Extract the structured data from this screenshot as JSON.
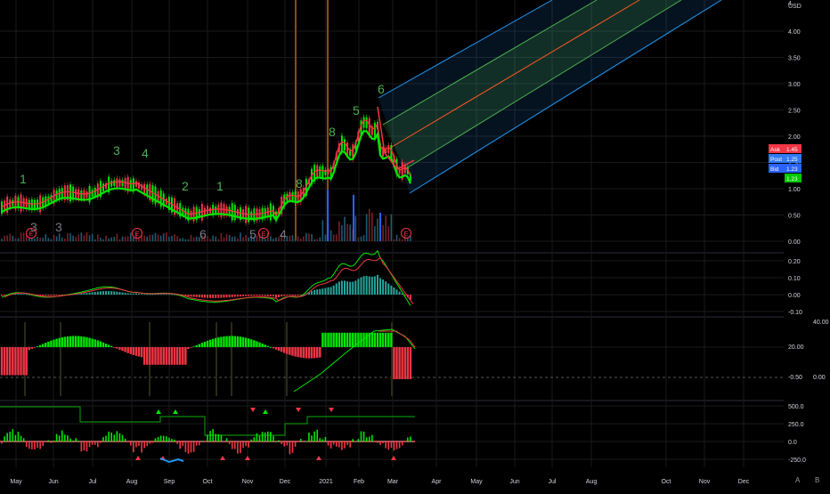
{
  "currency": "USD",
  "top_cut_label": "4",
  "price_axis": {
    "ticks": [
      "4.00",
      "3.50",
      "3.00",
      "2.50",
      "2.00",
      "1.50",
      "1.00",
      "0.50",
      "0.00"
    ],
    "ask_label": "Ask",
    "ask_value": "1.45",
    "post_label": "Post",
    "post_value": "1.25",
    "bid_label": "Bid",
    "bid_value": "1.23",
    "last_value": "1.23"
  },
  "time_axis": [
    "May",
    "Jun",
    "Jul",
    "Aug",
    "Sep",
    "Oct",
    "Nov",
    "Dec",
    "2021",
    "Feb",
    "Mar",
    "Apr",
    "May",
    "Jun",
    "Jul",
    "Aug",
    "Oct",
    "Nov",
    "Dec"
  ],
  "earnings_marker": "E",
  "td_counts": [
    {
      "text": "1",
      "tone": "green"
    },
    {
      "text": "3",
      "tone": "green"
    },
    {
      "text": "4",
      "tone": "green"
    },
    {
      "text": "2",
      "tone": "green"
    },
    {
      "text": "1",
      "tone": "green"
    },
    {
      "text": "8",
      "tone": "green"
    },
    {
      "text": "8",
      "tone": "green"
    },
    {
      "text": "5",
      "tone": "green"
    },
    {
      "text": "6",
      "tone": "green"
    },
    {
      "text": "3",
      "tone": "gray"
    },
    {
      "text": "3",
      "tone": "gray"
    },
    {
      "text": "6",
      "tone": "gray"
    },
    {
      "text": "5",
      "tone": "gray"
    },
    {
      "text": "4",
      "tone": "gray"
    }
  ],
  "panes": {
    "macd": {
      "ticks": [
        "0.20",
        "0.10",
        "0.00",
        "-0.10"
      ]
    },
    "momentum": {
      "ticks": [
        "40.00",
        "20.00",
        "-0.50",
        "0.00"
      ]
    },
    "oscillator": {
      "ticks": [
        "500.0",
        "250.0",
        "0.0",
        "-250.0"
      ]
    }
  },
  "colors": {
    "background": "#000000",
    "bull": "#26a69a",
    "bright_green": "#00e600",
    "bear": "#f23645",
    "ask": "#f23645",
    "post": "#2962ff",
    "bid": "#3179f5",
    "last": "#00c800",
    "channel_outer": "#2196f3",
    "channel_inner": "#4caf50",
    "channel_mid": "#ff5722",
    "vertical_line": "#8d4a10",
    "grid": "#1a1a1a"
  },
  "corner_buttons": {
    "left": "A",
    "right": "B"
  }
}
